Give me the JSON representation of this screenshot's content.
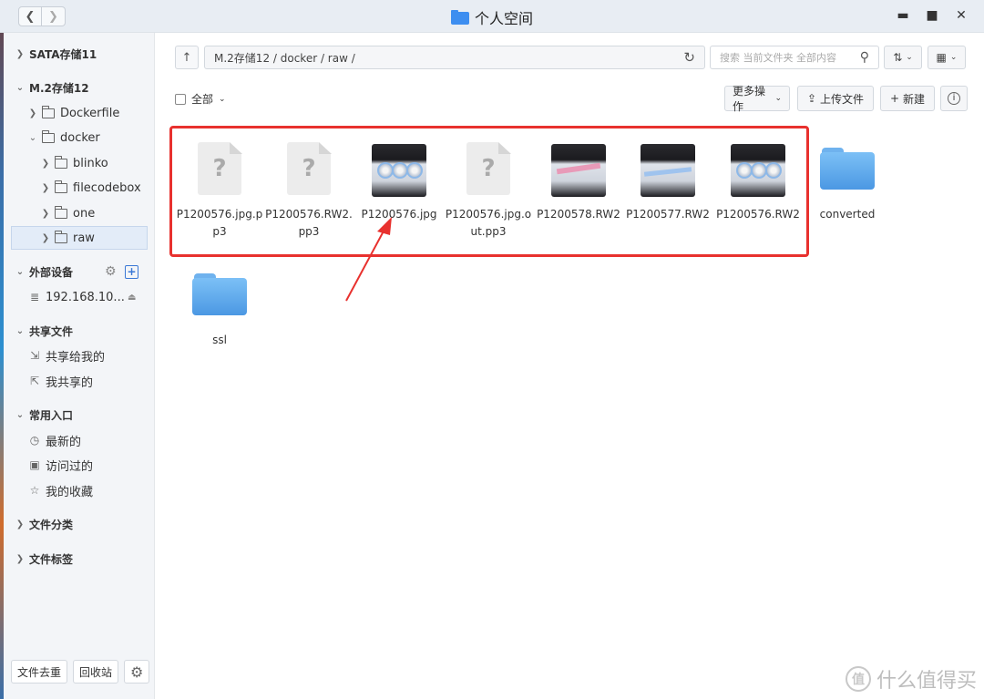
{
  "window": {
    "title": "个人空间"
  },
  "toolbar": {
    "path": "M.2存储12 / docker / raw /",
    "search_placeholder": "搜索 当前文件夹 全部内容"
  },
  "actions": {
    "select_all": "全部",
    "more": "更多操作",
    "upload": "上传文件",
    "new": "新建"
  },
  "sidebar": {
    "sata": "SATA存储11",
    "m2": "M.2存储12",
    "dockerfile": "Dockerfile",
    "docker": "docker",
    "blinko": "blinko",
    "filecodebox": "filecodebox",
    "one": "one",
    "raw": "raw",
    "external": "外部设备",
    "ip": "192.168.10...",
    "shared": "共享文件",
    "shared_to_me": "共享给我的",
    "my_shared": "我共享的",
    "common": "常用入口",
    "recent": "最新的",
    "visited": "访问过的",
    "favorites": "我的收藏",
    "categories": "文件分类",
    "tags": "文件标签",
    "dedupe": "文件去重",
    "recycle": "回收站"
  },
  "files": [
    {
      "name": "P1200576.jpg.pp3",
      "type": "unknown"
    },
    {
      "name": "P1200576.RW2.pp3",
      "type": "unknown"
    },
    {
      "name": "P1200576.jpg",
      "type": "photo"
    },
    {
      "name": "P1200576.jpg.out.pp3",
      "type": "unknown"
    },
    {
      "name": "P1200578.RW2",
      "type": "photo"
    },
    {
      "name": "P1200577.RW2",
      "type": "photo"
    },
    {
      "name": "P1200576.RW2",
      "type": "photo"
    },
    {
      "name": "converted",
      "type": "folder"
    },
    {
      "name": "ssl",
      "type": "folder"
    }
  ],
  "watermark": {
    "text": "什么值得买"
  },
  "colors": {
    "highlight": "#e8312e",
    "folder": "#5aa6ec",
    "selected": "#e3ecf8"
  }
}
